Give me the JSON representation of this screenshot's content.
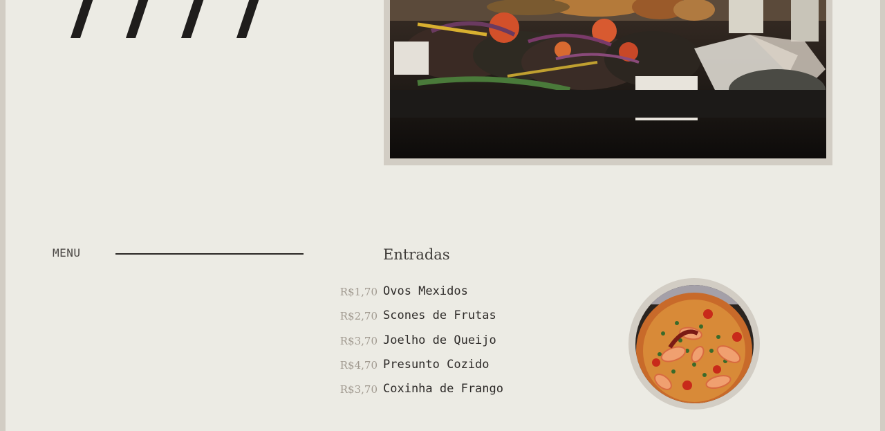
{
  "menu": {
    "label": "MENU"
  },
  "section": {
    "title": "Entradas"
  },
  "items": [
    {
      "price": "R$1,70",
      "name": "Ovos Mexidos"
    },
    {
      "price": "R$2,70",
      "name": "Scones de Frutas"
    },
    {
      "price": "R$3,70",
      "name": "Joelho de Queijo"
    },
    {
      "price": "R$4,70",
      "name": "Presunto Cozido"
    },
    {
      "price": "R$3,70",
      "name": "Coxinha de Frango"
    }
  ],
  "colors": {
    "page_background": "#ecebe4",
    "frame": "#d2cdc4",
    "price_text": "#a19a90",
    "dish_text": "#2d2a28",
    "slash_marks": "#1f1d1c"
  }
}
